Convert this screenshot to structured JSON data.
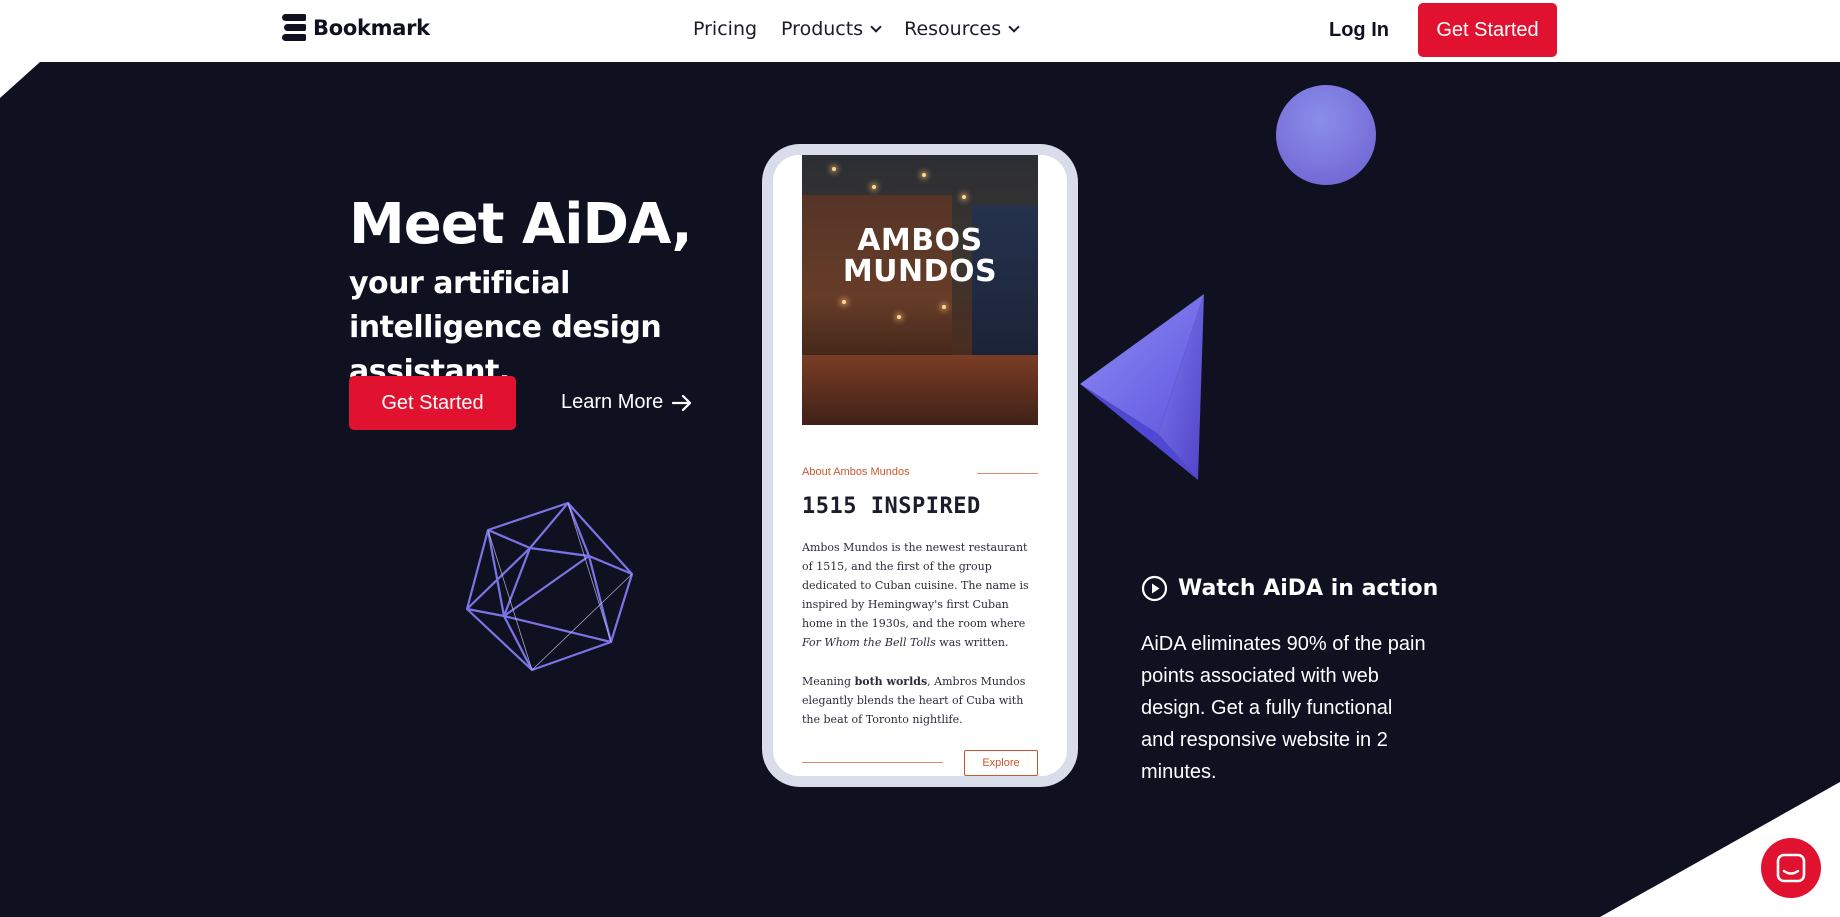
{
  "nav": {
    "logo_text": "Bookmark",
    "links": [
      {
        "label": "Pricing",
        "has_dropdown": false
      },
      {
        "label": "Products",
        "has_dropdown": true
      },
      {
        "label": "Resources",
        "has_dropdown": true
      }
    ],
    "login_label": "Log In",
    "cta_label": "Get Started"
  },
  "hero": {
    "headline": "Meet AiDA,",
    "subhead": "your artificial intelligence design assistant.",
    "cta_label": "Get Started",
    "learn_more_label": "Learn More"
  },
  "phone": {
    "photo_title_line1": "AMBOS",
    "photo_title_line2": "MUNDOS",
    "about_label": "About Ambos Mundos",
    "heading": "1515 INSPIRED",
    "paragraph1_a": "Ambos Mundos is the newest restaurant of 1515, and the first of the group dedicated to Cuban cuisine. The name is inspired by Hemingway's first Cuban home in the 1930s, and the room where ",
    "paragraph1_em": "For Whom the Bell Tolls",
    "paragraph1_b": " was written.",
    "paragraph2_a": "Meaning ",
    "paragraph2_strong": "both worlds",
    "paragraph2_b": ", Ambros Mundos elegantly blends the heart of Cuba with the beat of Toronto nightlife.",
    "explore_label": "Explore"
  },
  "watch": {
    "label": "Watch AiDA in action",
    "description": "AiDA eliminates 90% of the pain points associated with web design. Get a fully functional and responsive website in 2 minutes."
  },
  "icons": {
    "play": "play-circle-icon",
    "arrow": "arrow-right-icon",
    "chevron": "chevron-down-icon",
    "chat": "chat-icon"
  },
  "colors": {
    "accent": "#e1122f",
    "hero_bg": "#0f1121",
    "shape_purple": "#7b74e6",
    "phone_accent": "#c9582e"
  }
}
